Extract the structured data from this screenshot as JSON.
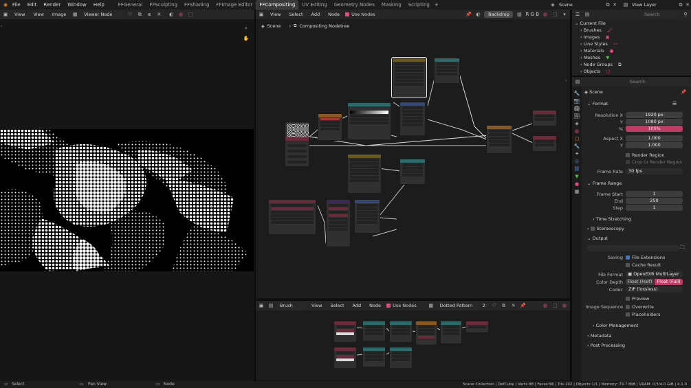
{
  "topbar": {
    "menus": [
      "File",
      "Edit",
      "Render",
      "Window",
      "Help"
    ],
    "tabs": [
      "FFGeneral",
      "FFSculpting",
      "FFShading",
      "FFImage Editor",
      "FFCompositing",
      "UV Editing",
      "Geometry Nodes",
      "Masking",
      "Scripting"
    ],
    "active_tab": "FFCompositing",
    "scene": "Scene",
    "view_layer": "View Layer"
  },
  "image_editor": {
    "menus": [
      "View",
      "View",
      "Image"
    ],
    "image_name": "Viewer Node"
  },
  "node_editor": {
    "menus": [
      "View",
      "Select",
      "Add",
      "Node"
    ],
    "use_nodes_label": "Use Nodes",
    "backdrop_label": "Backdrop",
    "rgb": "R G B",
    "breadcrumb_scene": "Scene",
    "breadcrumb_tree": "Compositing Nodetree"
  },
  "texture_editor": {
    "mode": "Brush",
    "menus": [
      "View",
      "Select",
      "Add",
      "Node"
    ],
    "use_nodes_label": "Use Nodes",
    "texture_name": "Dotted Pattern",
    "users": "2"
  },
  "outliner": {
    "search_placeholder": "Search",
    "root": "Current File",
    "items": [
      "Brushes",
      "Images",
      "Line Styles",
      "Materials",
      "Meshes",
      "Node Groups",
      "Objects"
    ]
  },
  "properties": {
    "search_placeholder": "Search",
    "context": "Scene",
    "format_header": "Format",
    "resolution_x_label": "Resolution X",
    "resolution_x": "1920 px",
    "resolution_y_label": "Y",
    "resolution_y": "1080 px",
    "percent_label": "%",
    "percent": "100%",
    "aspect_x_label": "Aspect X",
    "aspect_x": "1.000",
    "aspect_y_label": "Y",
    "aspect_y": "1.000",
    "render_region": "Render Region",
    "crop_region": "Crop to Render Region",
    "frame_rate_label": "Frame Rate",
    "frame_rate": "30 fps",
    "frame_range_header": "Frame Range",
    "frame_start_label": "Frame Start",
    "frame_start": "1",
    "end_label": "End",
    "end": "250",
    "step_label": "Step",
    "step": "1",
    "time_stretching": "Time Stretching",
    "stereoscopy": "Stereoscopy",
    "output_header": "Output",
    "saving_label": "Saving",
    "file_extensions": "File Extensions",
    "cache_result": "Cache Result",
    "file_format_label": "File Format",
    "file_format": "OpenEXR MultiLayer",
    "color_depth_label": "Color Depth",
    "depth_half": "Float (Half)",
    "depth_full": "Float (Full)",
    "codec_label": "Codec",
    "codec": "ZIP (lossless)",
    "preview": "Preview",
    "image_sequence_label": "Image Sequence",
    "overwrite": "Overwrite",
    "placeholders": "Placeholders",
    "color_management": "Color Management",
    "metadata": "Metadata",
    "post_processing": "Post Processing"
  },
  "statusbar": {
    "select": "Select",
    "pan_view": "Pan View",
    "node": "Node",
    "stats": "Scene Collection | DefCube | Verts:98 | Faces:96 | Tris:192 | Objects:1/1 | Memory: 79.7 MiB | VRAM: 0.5/4.0 GiB | 4.1.0"
  },
  "colors": {
    "accent": "#e24a7c",
    "selected_blue": "#4772b3",
    "bg": "#161616"
  }
}
